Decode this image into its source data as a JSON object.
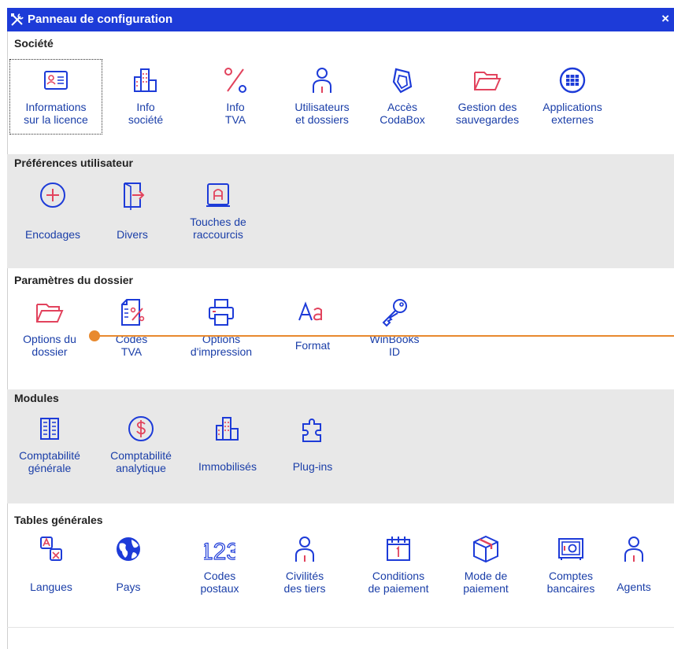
{
  "window": {
    "title": "Panneau de configuration",
    "close_label": "×"
  },
  "colors": {
    "titlebar": "#1d3bd8",
    "icon_blue": "#1d3bd8",
    "icon_red": "#e2435d",
    "label": "#1a3ea8",
    "overlay": "#e8892e"
  },
  "sections": [
    {
      "title": "Société",
      "items": [
        {
          "line1": "Informations",
          "line2": "sur la licence",
          "icon": "id-card-icon"
        },
        {
          "line1": "Info",
          "line2": "société",
          "icon": "building-icon"
        },
        {
          "line1": "Info",
          "line2": "TVA",
          "icon": "percent-icon"
        },
        {
          "line1": "Utilisateurs",
          "line2": "et dossiers",
          "icon": "user-icon"
        },
        {
          "line1": "Accès",
          "line2": "CodaBox",
          "icon": "codabox-icon"
        },
        {
          "line1": "Gestion des",
          "line2": "sauvegardes",
          "icon": "folder-icon"
        },
        {
          "line1": "Applications",
          "line2": "externes",
          "icon": "app-grid-icon"
        }
      ]
    },
    {
      "title": "Préférences utilisateur",
      "items": [
        {
          "line1": "Encodages",
          "line2": "",
          "icon": "plus-circle-icon"
        },
        {
          "line1": "Divers",
          "line2": "",
          "icon": "door-arrow-icon"
        },
        {
          "line1": "Touches de",
          "line2": "raccourcis",
          "icon": "keyboard-key-icon"
        }
      ]
    },
    {
      "title": "Paramètres du dossier",
      "items": [
        {
          "line1": "Options du",
          "line2": "dossier",
          "icon": "folder-icon"
        },
        {
          "line1": "Codes",
          "line2": "TVA",
          "icon": "doc-percent-icon"
        },
        {
          "line1": "Options",
          "line2": "d'impression",
          "icon": "printer-icon"
        },
        {
          "line1": "Format",
          "line2": "",
          "icon": "font-format-icon"
        },
        {
          "line1": "WinBooks",
          "line2": "ID",
          "icon": "key-icon"
        }
      ]
    },
    {
      "title": "Modules",
      "items": [
        {
          "line1": "Comptabilité",
          "line2": "générale",
          "icon": "ledger-icon"
        },
        {
          "line1": "Comptabilité",
          "line2": "analytique",
          "icon": "dollar-circle-icon"
        },
        {
          "line1": "Immobilisés",
          "line2": "",
          "icon": "building-icon"
        },
        {
          "line1": "Plug-ins",
          "line2": "",
          "icon": "puzzle-icon"
        }
      ]
    },
    {
      "title": "Tables générales",
      "items": [
        {
          "line1": "Langues",
          "line2": "",
          "icon": "translate-icon"
        },
        {
          "line1": "Pays",
          "line2": "",
          "icon": "globe-icon"
        },
        {
          "line1": "Codes",
          "line2": "postaux",
          "icon": "numbers-123-icon"
        },
        {
          "line1": "Civilités",
          "line2": "des tiers",
          "icon": "user-icon"
        },
        {
          "line1": "Conditions",
          "line2": "de paiement",
          "icon": "calendar-icon"
        },
        {
          "line1": "Mode de",
          "line2": "paiement",
          "icon": "package-icon"
        },
        {
          "line1": "Comptes",
          "line2": "bancaires",
          "icon": "safe-icon"
        },
        {
          "line1": "Agents",
          "line2": "",
          "icon": "user-icon"
        }
      ]
    }
  ]
}
